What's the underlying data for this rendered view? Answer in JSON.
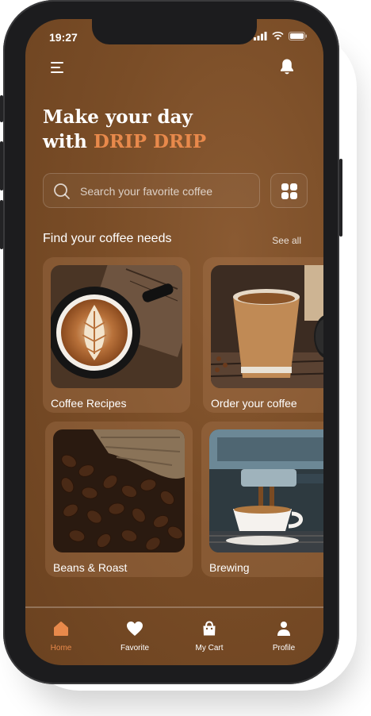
{
  "status_bar": {
    "time": "19:27"
  },
  "headline": {
    "line1": "Make your day",
    "line2_prefix": "with ",
    "brand": "DRIP DRIP"
  },
  "search": {
    "placeholder": "Search your favorite coffee"
  },
  "section": {
    "title": "Find your coffee needs",
    "see_all": "See all"
  },
  "categories": [
    {
      "label": "Coffee Recipes"
    },
    {
      "label": "Order your coffee"
    },
    {
      "label": "Beans & Roast"
    },
    {
      "label": "Brewing"
    }
  ],
  "nav": {
    "items": [
      {
        "label": "Home",
        "icon": "home-icon",
        "active": true
      },
      {
        "label": "Favorite",
        "icon": "heart-icon",
        "active": false
      },
      {
        "label": "My Cart",
        "icon": "cart-icon",
        "active": false
      },
      {
        "label": "Profile",
        "icon": "profile-icon",
        "active": false
      }
    ]
  },
  "colors": {
    "accent": "#e8894b",
    "background": "#7a4d27"
  }
}
